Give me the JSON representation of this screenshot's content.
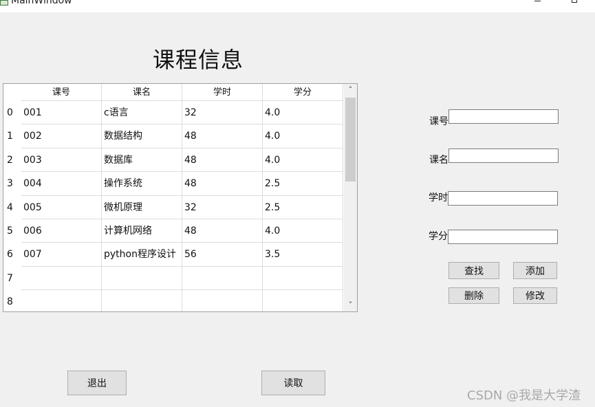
{
  "window": {
    "title": "MainWindow"
  },
  "page_title": "课程信息",
  "table": {
    "columns": [
      "课号",
      "课名",
      "学时",
      "学分"
    ],
    "row_headers": [
      "0",
      "1",
      "2",
      "3",
      "4",
      "5",
      "6",
      "7",
      "8"
    ],
    "rows": [
      [
        "001",
        "c语言",
        "32",
        "4.0"
      ],
      [
        "002",
        "数据结构",
        "48",
        "4.0"
      ],
      [
        "003",
        "数据库",
        "48",
        "4.0"
      ],
      [
        "004",
        "操作系统",
        "48",
        "2.5"
      ],
      [
        "005",
        "微机原理",
        "32",
        "2.5"
      ],
      [
        "006",
        "计算机网络",
        "48",
        "4.0"
      ],
      [
        "007",
        "python程序设计",
        "56",
        "3.5"
      ],
      [
        "",
        "",
        "",
        ""
      ],
      [
        "",
        "",
        "",
        ""
      ]
    ]
  },
  "form": {
    "course_id": {
      "label": "课号",
      "value": ""
    },
    "course_name": {
      "label": "课名",
      "value": ""
    },
    "hours": {
      "label": "学时",
      "value": ""
    },
    "credits": {
      "label": "学分",
      "value": ""
    }
  },
  "buttons": {
    "search": "查找",
    "add": "添加",
    "delete": "删除",
    "modify": "修改",
    "exit": "退出",
    "read": "读取"
  },
  "watermark": "CSDN @我是大学渣"
}
